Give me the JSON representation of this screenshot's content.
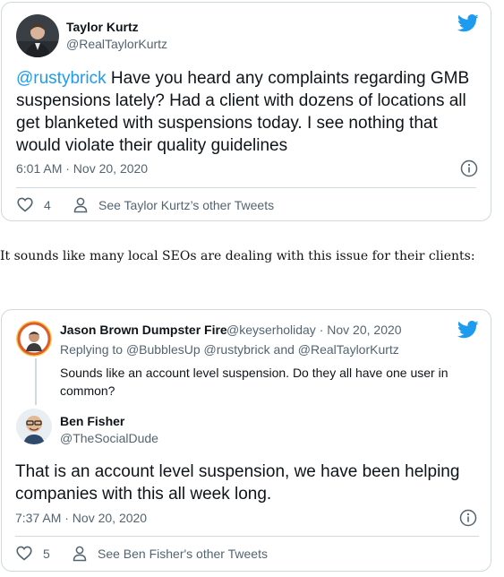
{
  "tweet1": {
    "author_name": "Taylor Kurtz",
    "author_handle": "@RealTaylorKurtz",
    "mention": "@rustybrick",
    "text": " Have you heard any complaints regarding GMB suspensions lately? Had a client with dozens of locations all get blanketed with suspensions today. I see nothing that would violate their quality guidelines",
    "timestamp": "6:01 AM · Nov 20, 2020",
    "like_count": "4",
    "other_tweets_label": "See Taylor Kurtz’s other Tweets"
  },
  "between_text": "It sounds like many local SEOs are dealing with this issue for their clients:",
  "tweet2": {
    "quoted": {
      "author_name": "Jason Brown Dumpster Fire",
      "author_handle": "@keyserholiday",
      "separator": " · ",
      "date": "Nov 20, 2020",
      "replying_prefix": "Replying to ",
      "replying_to": "@BubblesUp @rustybrick and @RealTaylorKurtz",
      "text": "Sounds like an account level suspension. Do they all have one user in common?"
    },
    "author_name": "Ben Fisher",
    "author_handle": "@TheSocialDude",
    "text": "That is an account level suspension, we have been helping companies with this all week long.",
    "timestamp": "7:37 AM · Nov 20, 2020",
    "like_count": "5",
    "other_tweets_label": "See Ben Fisher's other Tweets"
  },
  "icons": [
    "twitter-bird-icon",
    "info-icon",
    "heart-icon",
    "person-icon"
  ],
  "colors": {
    "accent": "#1d9bf0",
    "text": "#0f1419",
    "muted": "#536471",
    "border": "#cfd9de"
  }
}
